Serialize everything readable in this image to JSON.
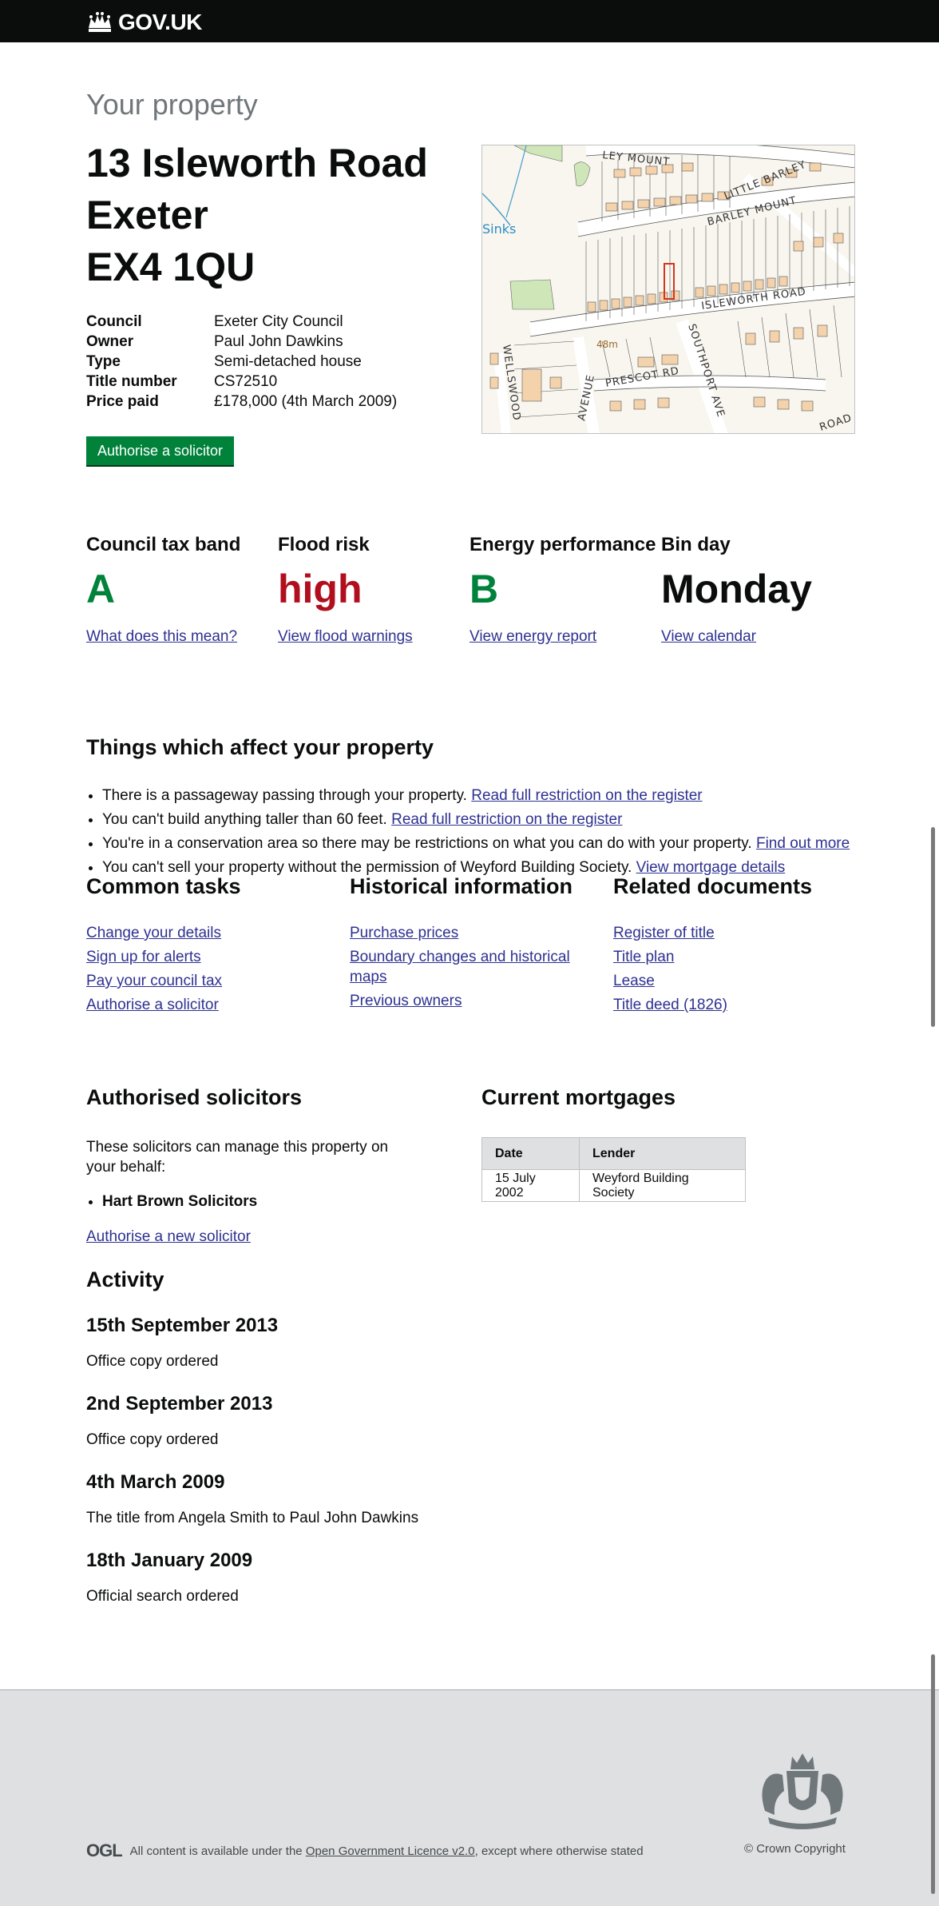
{
  "header": {
    "logo_text": "GOV.UK",
    "logo_icon": "crown-icon"
  },
  "page": {
    "eyebrow": "Your property",
    "address_lines": [
      "13 Isleworth Road",
      "Exeter",
      "EX4 1QU"
    ]
  },
  "summary": [
    {
      "label": "Council",
      "value": "Exeter City Council"
    },
    {
      "label": "Owner",
      "value": "Paul John Dawkins"
    },
    {
      "label": "Type",
      "value": "Semi-detached house"
    },
    {
      "label": "Title number",
      "value": "CS72510"
    },
    {
      "label": "Price paid",
      "value": "£178,000 (4th March 2009)"
    }
  ],
  "authorise_button": "Authorise a solicitor",
  "map": {
    "labels": [
      "LEY MOUNT",
      "LITTLE BARLEY",
      "BARLEY MOUNT",
      "Sinks",
      "ISLEWORTH ROAD",
      "48m",
      "PRESCOT RD",
      "SOUTHPORT AVE",
      "WELLSWOOD",
      "AVENUE",
      "ROAD"
    ]
  },
  "facts": [
    {
      "heading": "Council tax band",
      "value": "A",
      "color": "#00823b",
      "link": "What does this mean?"
    },
    {
      "heading": "Flood risk",
      "value": "high",
      "color": "#b10e1e",
      "link": "View flood warnings"
    },
    {
      "heading": "Energy performance",
      "value": "B",
      "color": "#00823b",
      "link": "View energy report"
    },
    {
      "heading": "Bin day",
      "value": "Monday",
      "color": "#0b0c0c",
      "link": "View calendar"
    }
  ],
  "affects": {
    "heading": "Things which affect your property",
    "items": [
      {
        "text": "There is a passageway passing through your property.",
        "link": "Read full restriction on the register"
      },
      {
        "text": "You can't build anything taller than 60 feet.",
        "link": "Read full restriction on the register"
      },
      {
        "text": "You're in a conservation area so there may be restrictions on what you can do with your property.",
        "link": "Find out more"
      },
      {
        "text": "You can't sell your property without the permission of Weyford Building Society.",
        "link": "View mortgage details"
      }
    ]
  },
  "common_tasks": {
    "heading": "Common tasks",
    "links": [
      "Change your details",
      "Sign up for alerts",
      "Pay your council tax",
      "Authorise a solicitor"
    ]
  },
  "historical": {
    "heading": "Historical information",
    "links": [
      "Purchase prices",
      "Boundary changes and historical maps",
      "Previous owners"
    ]
  },
  "related": {
    "heading": "Related documents",
    "links": [
      "Register of title",
      "Title plan",
      "Lease",
      "Title deed (1826)"
    ]
  },
  "solicitors": {
    "heading": "Authorised solicitors",
    "intro": "These solicitors can manage this property on your behalf:",
    "list": [
      "Hart Brown Solicitors"
    ],
    "link": "Authorise a new solicitor"
  },
  "mortgages": {
    "heading": "Current mortgages",
    "columns": [
      "Date",
      "Lender"
    ],
    "rows": [
      [
        "15 July 2002",
        "Weyford Building Society"
      ]
    ]
  },
  "activity": {
    "heading": "Activity",
    "events": [
      {
        "date": "15th September 2013",
        "text": "Office copy ordered"
      },
      {
        "date": "2nd September 2013",
        "text": "Office copy ordered"
      },
      {
        "date": "4th March 2009",
        "text": "The title from Angela Smith to Paul John Dawkins"
      },
      {
        "date": "18th January 2009",
        "text": "Official search ordered"
      }
    ]
  },
  "footer": {
    "ogl_mark": "OGL",
    "licence_prefix": "All content is available under the",
    "licence_link": "Open Government Licence v2.0",
    "licence_suffix": ", except where otherwise stated",
    "copyright": "© Crown Copyright"
  }
}
